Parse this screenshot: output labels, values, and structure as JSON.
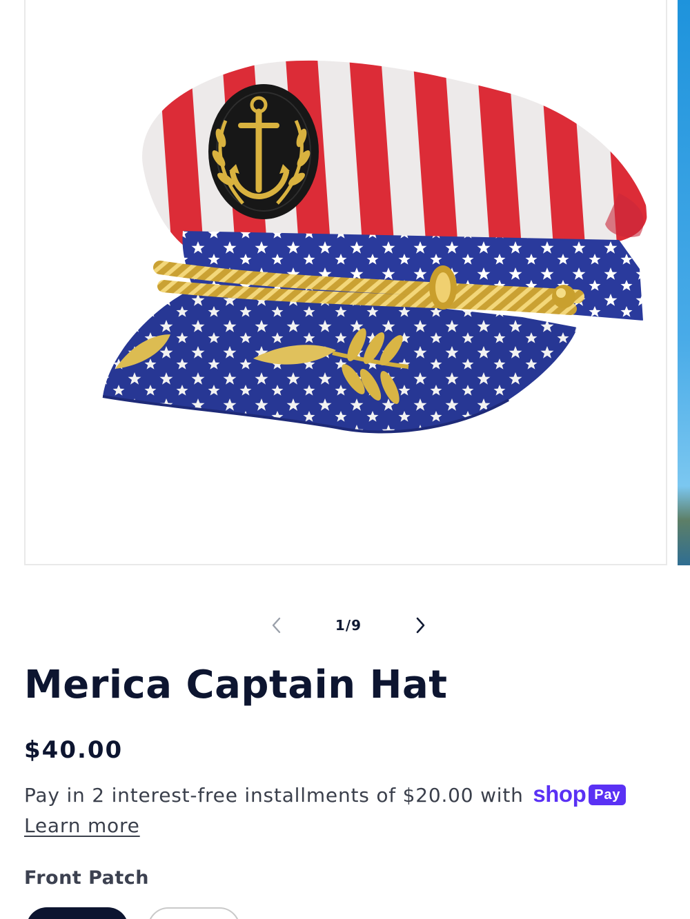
{
  "gallery": {
    "image_alt": "Merica Captain Hat",
    "counter": "1/9",
    "prev_icon": "chevron-left-icon",
    "next_icon": "chevron-right-icon"
  },
  "product": {
    "title": "Merica Captain Hat",
    "price": "$40.00",
    "installments_text": "Pay in 2 interest-free installments of $20.00 with",
    "shop_pay": {
      "shop": "shop",
      "pay": "Pay"
    },
    "learn_more": "Learn more"
  },
  "options": {
    "label": "Front Patch"
  },
  "colors": {
    "text_dark": "#0d1530",
    "shop_pay_purple": "#5a31f4",
    "stripe_red": "#e52e3a",
    "navy": "#2a3a9c",
    "gold": "#d8b13c"
  }
}
